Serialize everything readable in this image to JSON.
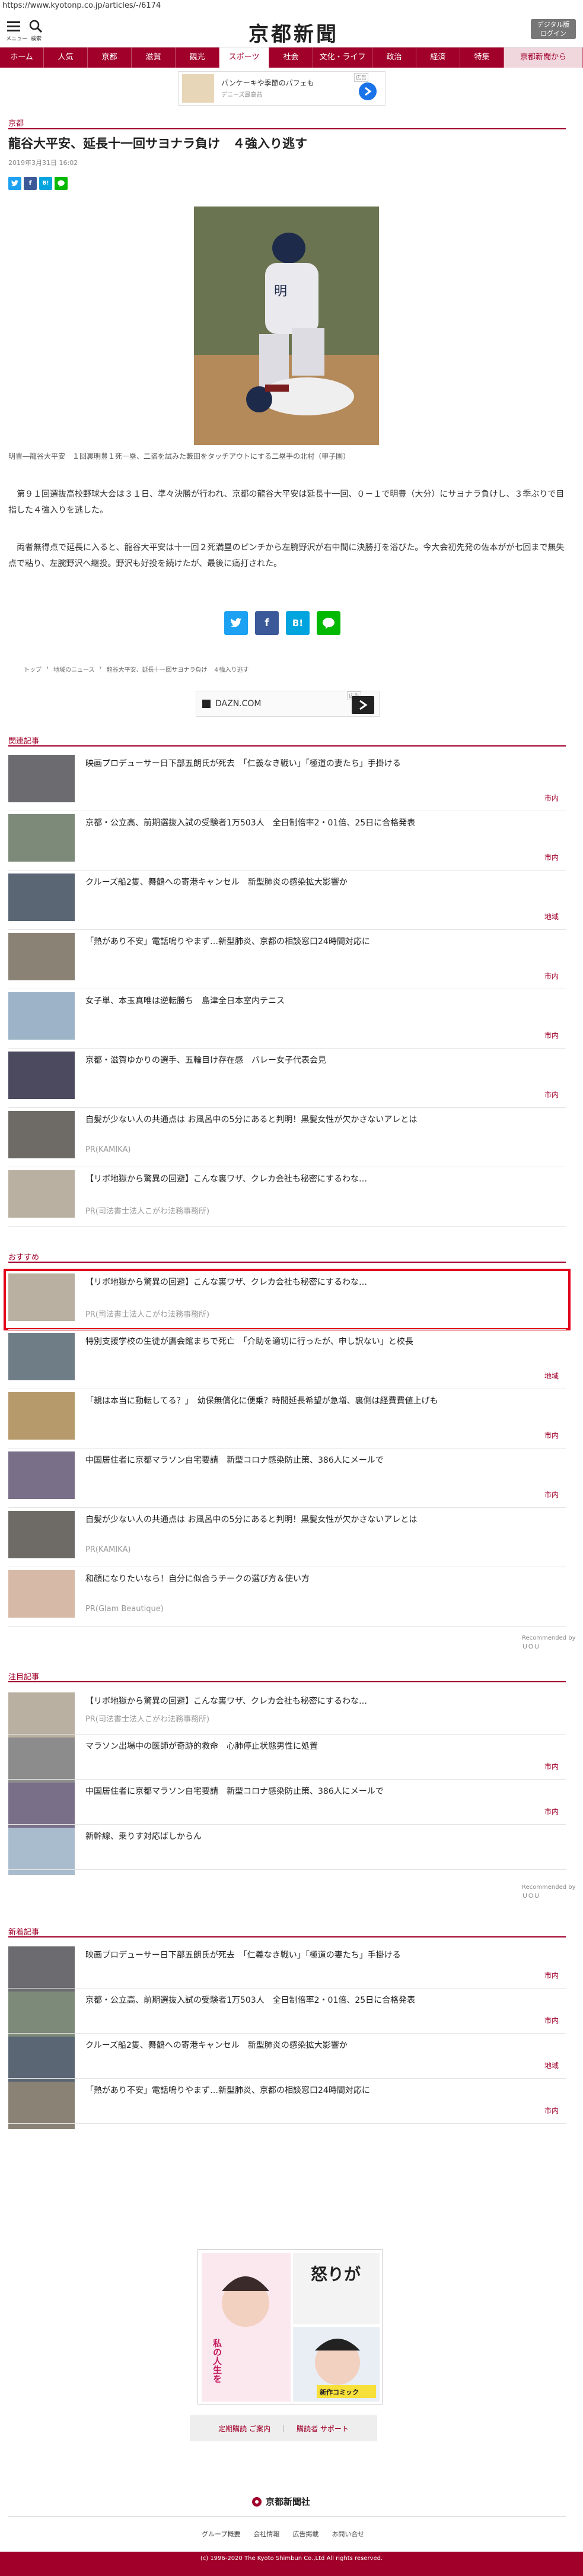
{
  "browser": {
    "url": "https://www.kyotonp.co.jp/articles/-/6174"
  },
  "header": {
    "menu_label": "メニュー",
    "search_label": "検索",
    "logo": "京都新聞",
    "digital_button": "デジタル版\nログイン"
  },
  "nav": [
    {
      "label": "ホーム"
    },
    {
      "label": "人気"
    },
    {
      "label": "京都"
    },
    {
      "label": "滋賀"
    },
    {
      "label": "観光"
    },
    {
      "label": "スポーツ",
      "active": true
    },
    {
      "label": "社会"
    },
    {
      "label": "文化・ライフ"
    },
    {
      "label": "政治"
    },
    {
      "label": "経済"
    },
    {
      "label": "特集"
    },
    {
      "label": "京都新聞から",
      "special": true
    }
  ],
  "top_ad": {
    "text": "パンケーキや季節のパフェも",
    "sub": "デニーズ最高益",
    "badge": "広告"
  },
  "article": {
    "section": "京都",
    "title": "龍谷大平安、延長十一回サヨナラ負け　４強入り逃す",
    "date": "2019年3月31日 16:02",
    "caption": "明豊―龍谷大平安　１回裏明豊１死一塁、二盗を試みた藪田をタッチアウトにする二塁手の北村（甲子園）",
    "paragraphs": [
      "　第９１回選抜高校野球大会は３１日、準々決勝が行われ、京都の龍谷大平安は延長十一回、０－１で明豊（大分）にサヨナラ負けし、３季ぶりで目指した４強入りを逃した。",
      "　両者無得点で延長に入ると、龍谷大平安は十一回２死満塁のピンチから左腕野沢が右中間に決勝打を浴びた。今大会初先発の佐本がが七回まで無失点で粘り、左腕野沢へ継投。野沢も好投を続けたが、最後に痛打された。"
    ],
    "share": {
      "twitter": "t",
      "facebook": "f",
      "hatena": "B!",
      "line": "LINE"
    },
    "breadcrumb": [
      "トップ",
      "地域のニュース",
      "龍谷大平安、延長十一回サヨナラ負け　４強入り逃す"
    ],
    "ad_box": {
      "text": "DAZN.COM",
      "badge": "広告"
    }
  },
  "related": {
    "heading": "関連記事",
    "items": [
      {
        "title": "映画プロデューサー日下部五朗氏が死去　「仁義なき戦い」「極道の妻たち」手掛ける",
        "cat": "市内",
        "thumb": "#6b6b70"
      },
      {
        "title": "京都・公立高、前期選抜入試の受験者1万503人　全日制倍率2・01倍、25日に合格発表",
        "cat": "市内",
        "thumb": "#7d8a7a"
      },
      {
        "title": "クルーズ船2隻、舞鶴への寄港キャンセル　新型肺炎の感染拡大影響か",
        "cat": "地域",
        "thumb": "#5a6673"
      },
      {
        "title": "「熱があり不安」電話鳴りやまず…新型肺炎、京都の相談窓口24時間対応に",
        "cat": "市内",
        "thumb": "#8a8275"
      },
      {
        "title": "女子単、本玉真唯は逆転勝ち　島津全日本室内テニス",
        "cat": "市内",
        "thumb": "#9db4c8"
      },
      {
        "title": "京都・滋賀ゆかりの選手、五輪目け存在感　バレー女子代表会見",
        "cat": "市内",
        "thumb": "#4b4a5e"
      },
      {
        "title": "自髪が少ない人の共通点は お風呂中の5分にあると判明！黒髪女性が欠かさないアレとは",
        "pr": "PR(KAMIKA)",
        "thumb": "#6e6a66"
      },
      {
        "title": "【リボ地獄から驚異の回避】こんな裏ワザ、クレカ会社も秘密にするわな…",
        "pr": "PR(司法書士法人こがわ法務事務所)",
        "thumb": "#b9b0a2"
      }
    ]
  },
  "recommended": {
    "heading": "おすすめ",
    "items": [
      {
        "title": "【リボ地獄から驚異の回避】こんな裏ワザ、クレカ会社も秘密にするわな…",
        "pr": "PR(司法書士法人こがわ法務事務所)",
        "thumb": "#b9b0a2",
        "highlight": true
      },
      {
        "title": "特別支援学校の生徒が鷹会館まちで死亡　「介助を適切に行ったが、申し訳ない」と校長",
        "cat": "地域",
        "thumb": "#6f7d86"
      },
      {
        "title": "「親は本当に動転してる？」　幼保無償化に便乗？時間延長希望が急増、裏側は経費費値上げも",
        "cat": "市内",
        "thumb": "#b79a6c"
      },
      {
        "title": "中国居住者に京都マラソン自宅要請　新型コロナ感染防止策、386人にメールで",
        "cat": "市内",
        "thumb": "#7a6f88"
      },
      {
        "title": "自髪が少ない人の共通点は お風呂中の5分にあると判明！黒髪女性が欠かさないアレとは",
        "pr": "PR(KAMIKA)",
        "thumb": "#6e6a66"
      },
      {
        "title": "和顔になりたいなら！自分に似合うチークの選び方＆使い方",
        "pr": "PR(Glam Beautique)",
        "thumb": "#d6b9a6"
      }
    ],
    "powered": "Recommended by ＵＯＵ"
  },
  "featured": {
    "heading": "注目記事",
    "items": [
      {
        "title": "【リボ地獄から驚異の回避】こんな裏ワザ、クレカ会社も秘密にするわな…",
        "pr": "PR(司法書士法人こがわ法務事務所)",
        "thumb": "#b9b0a2"
      },
      {
        "title": "マラソン出場中の医師が奇跡的救命　心肺停止状態男性に処置",
        "cat": "市内",
        "thumb": "#8c8c8c"
      },
      {
        "title": "中国居住者に京都マラソン自宅要請　新型コロナ感染防止策、386人にメールで",
        "cat": "市内",
        "thumb": "#7a6f88"
      },
      {
        "title": "新幹線、乗りす対応ばしからん",
        "thumb": "#a9bccd"
      }
    ],
    "powered": "Recommended by ＵＯＵ"
  },
  "latest": {
    "heading": "新着記事",
    "items": [
      {
        "title": "映画プロデューサー日下部五朗氏が死去　「仁義なき戦い」「極道の妻たち」手掛ける",
        "cat": "市内",
        "thumb": "#6b6b70"
      },
      {
        "title": "京都・公立高、前期選抜入試の受験者1万503人　全日制倍率2・01倍、25日に合格発表",
        "cat": "市内",
        "thumb": "#7d8a7a"
      },
      {
        "title": "クルーズ船2隻、舞鶴への寄港キャンセル　新型肺炎の感染拡大影響か",
        "cat": "地域",
        "thumb": "#5a6673"
      },
      {
        "title": "「熱があり不安」電話鳴りやまず…新型肺炎、京都の相談窓口24時間対応に",
        "cat": "市内",
        "thumb": "#8a8275"
      }
    ]
  },
  "bottom_ad": {
    "text1": "私の人生を",
    "text2": "怒りが",
    "badge": "新作コミック"
  },
  "footer": {
    "buttons": [
      "定期購読 ご案内",
      "購読者 サポート"
    ],
    "logo": "京都新聞社",
    "links": [
      "グループ概要",
      "会社情報",
      "広告掲載",
      "お問い合せ"
    ],
    "copyright": "(c) 1996-2020 The Kyoto Shimbun Co.,Ltd All rights reserved."
  },
  "colors": {
    "brand": "#a0002a",
    "twitter": "#1da1f2",
    "facebook": "#3b5998",
    "hatena": "#00a4de",
    "line": "#00b900"
  }
}
